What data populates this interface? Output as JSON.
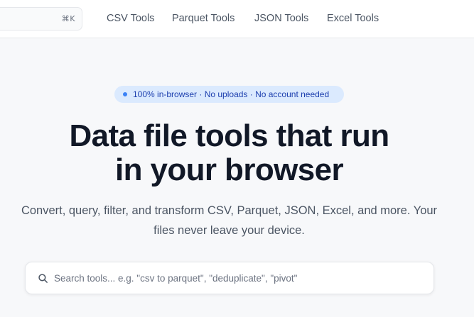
{
  "header": {
    "search_shortcut": "⌘K",
    "nav": [
      {
        "label": "CSV Tools"
      },
      {
        "label": "Parquet Tools"
      },
      {
        "label": "JSON Tools"
      },
      {
        "label": "Excel Tools"
      }
    ]
  },
  "hero": {
    "badge": "100% in-browser · No uploads · No account needed",
    "title_line1": "Data file tools that run",
    "title_line2": "in your browser",
    "subtitle_line1": "Convert, query, filter, and transform CSV, Parquet, JSON, Excel, and more. Your",
    "subtitle_line2": "files never leave your device."
  },
  "search": {
    "placeholder": "Search tools... e.g. \"csv to parquet\", \"deduplicate\", \"pivot\"",
    "icon": "search-icon"
  },
  "colors": {
    "page_bg": "#f7f8fa",
    "badge_bg": "#dbeafe",
    "badge_text": "#1e40af",
    "accent": "#3b82f6"
  }
}
